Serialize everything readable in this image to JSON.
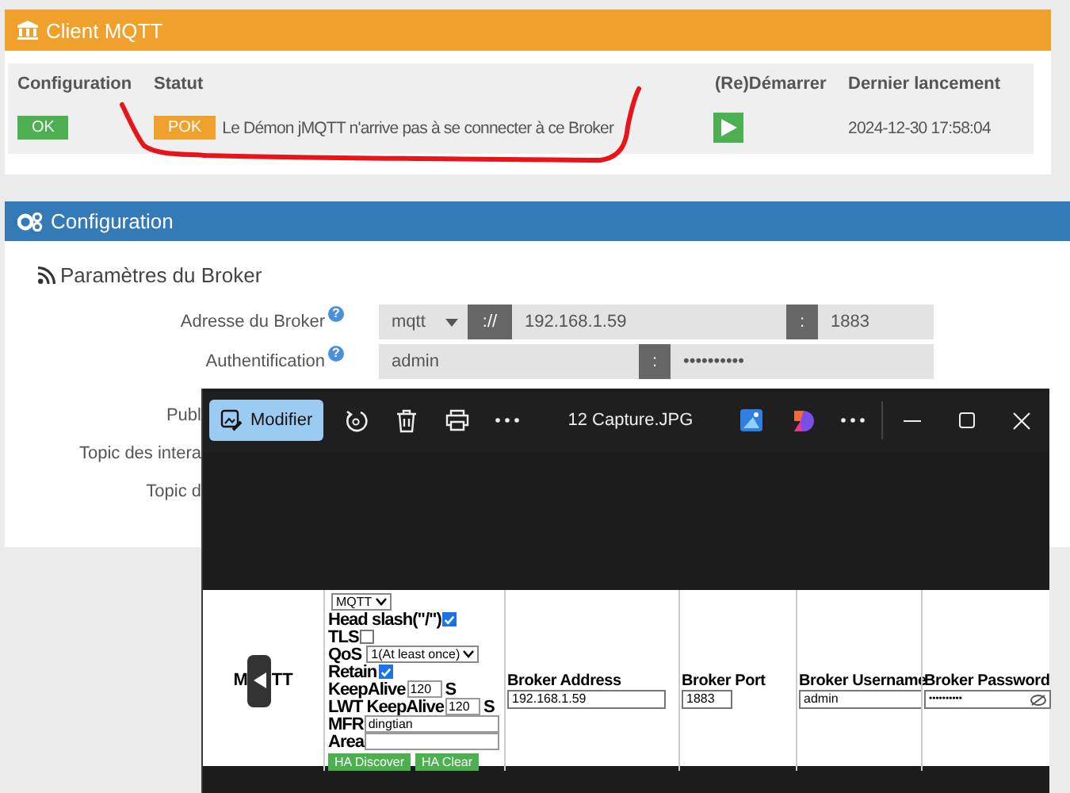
{
  "client_panel": {
    "title": "Client MQTT",
    "columns": [
      "Configuration",
      "Statut",
      "(Re)Démarrer",
      "Dernier lancement"
    ],
    "config_badge": "OK",
    "status_badge": "POK",
    "status_text": "Le Démon jMQTT n'arrive pas à se connecter à ce Broker",
    "last_launch": "2024-12-30 17:58:04"
  },
  "config_panel": {
    "title": "Configuration",
    "section": "Paramètres du Broker",
    "fields": [
      {
        "kind": "address",
        "label": "Adresse du Broker",
        "help": "?",
        "protocol": "mqtt",
        "separator": "://",
        "host": "192.168.1.59",
        "port_separator": ":",
        "port": "1883"
      },
      {
        "kind": "auth",
        "label": "Authentification",
        "help": "?",
        "username": "admin",
        "separator": ":",
        "password": "••••••••••"
      }
    ],
    "cut_labels": [
      "Publ",
      "Topic des intera",
      "Topic d"
    ]
  },
  "viewer": {
    "edit_button": "Modifier",
    "title": "12 Capture.JPG",
    "capture": {
      "side_label": [
        "M",
        "TT"
      ],
      "settings": [
        {
          "kind": "select",
          "value": "MQTT"
        },
        {
          "kind": "checkbox",
          "label": "Head slash(\"/\")",
          "checked": true
        },
        {
          "kind": "checkbox",
          "label": "TLS",
          "checked": false
        },
        {
          "kind": "select",
          "label": "QoS",
          "value": "1(At least once)"
        },
        {
          "kind": "checkbox",
          "label": "Retain",
          "checked": true
        },
        {
          "kind": "input",
          "label": "KeepAlive",
          "value": "120",
          "unit": "S"
        },
        {
          "kind": "input",
          "label": "LWT KeepAlive",
          "value": "120",
          "unit": "S"
        },
        {
          "kind": "input",
          "label": "MFR",
          "value": "dingtian"
        },
        {
          "kind": "input",
          "label": "Area"
        }
      ],
      "actions": [
        "HA Discover",
        "HA Clear"
      ],
      "fields": [
        {
          "kind": "text",
          "label": "Broker Address",
          "value": "192.168.1.59"
        },
        {
          "kind": "text",
          "label": "Broker Port",
          "value": "1883"
        },
        {
          "kind": "text",
          "label": "Broker Username",
          "value": "admin"
        },
        {
          "kind": "password",
          "label": "Broker Password",
          "value": "••••••••••"
        }
      ]
    }
  }
}
